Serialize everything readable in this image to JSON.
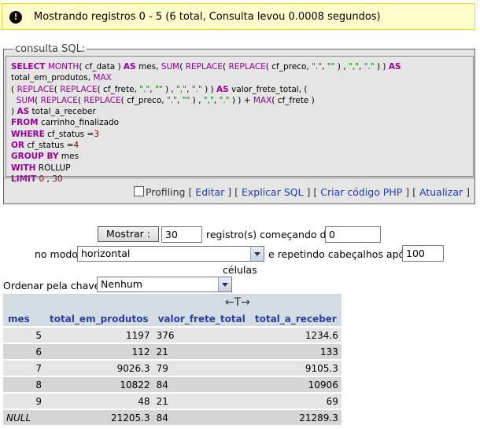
{
  "notice": {
    "icon": "info-icon",
    "text": "Mostrando registros 0 - 5 (6 total, Consulta levou 0.0008 segundos)"
  },
  "sql_box": {
    "legend": "consulta SQL:",
    "links": {
      "profiling": "Profiling",
      "edit": "Editar",
      "explain": "Explicar SQL",
      "php": "Criar código PHP",
      "refresh": "Atualizar"
    }
  },
  "navigation": {
    "show_button": "Mostrar :",
    "rows_value": "30",
    "records_label": "registro(s) começando de",
    "start_value": "0",
    "mode_label": "no modo",
    "mode_selected": "horizontal",
    "repeat_label": "e repetindo cabeçalhos após",
    "repeat_value": "100",
    "cells_label": "células",
    "sort_label": "Ordenar pela chave:",
    "sort_selected": "Nenhum"
  },
  "results": {
    "direction_icon": "←T→",
    "columns": [
      "mes",
      "total_em_produtos",
      "valor_frete_total",
      "total_a_receber"
    ],
    "rows": [
      [
        "5",
        "1197",
        "376",
        "1234.6"
      ],
      [
        "6",
        "112",
        "21",
        "133"
      ],
      [
        "7",
        "9026.3",
        "79",
        "9105.3"
      ],
      [
        "8",
        "10822",
        "84",
        "10906"
      ],
      [
        "9",
        "48",
        "21",
        "69"
      ],
      [
        "NULL",
        "21205.3",
        "84",
        "21289.3"
      ]
    ]
  }
}
